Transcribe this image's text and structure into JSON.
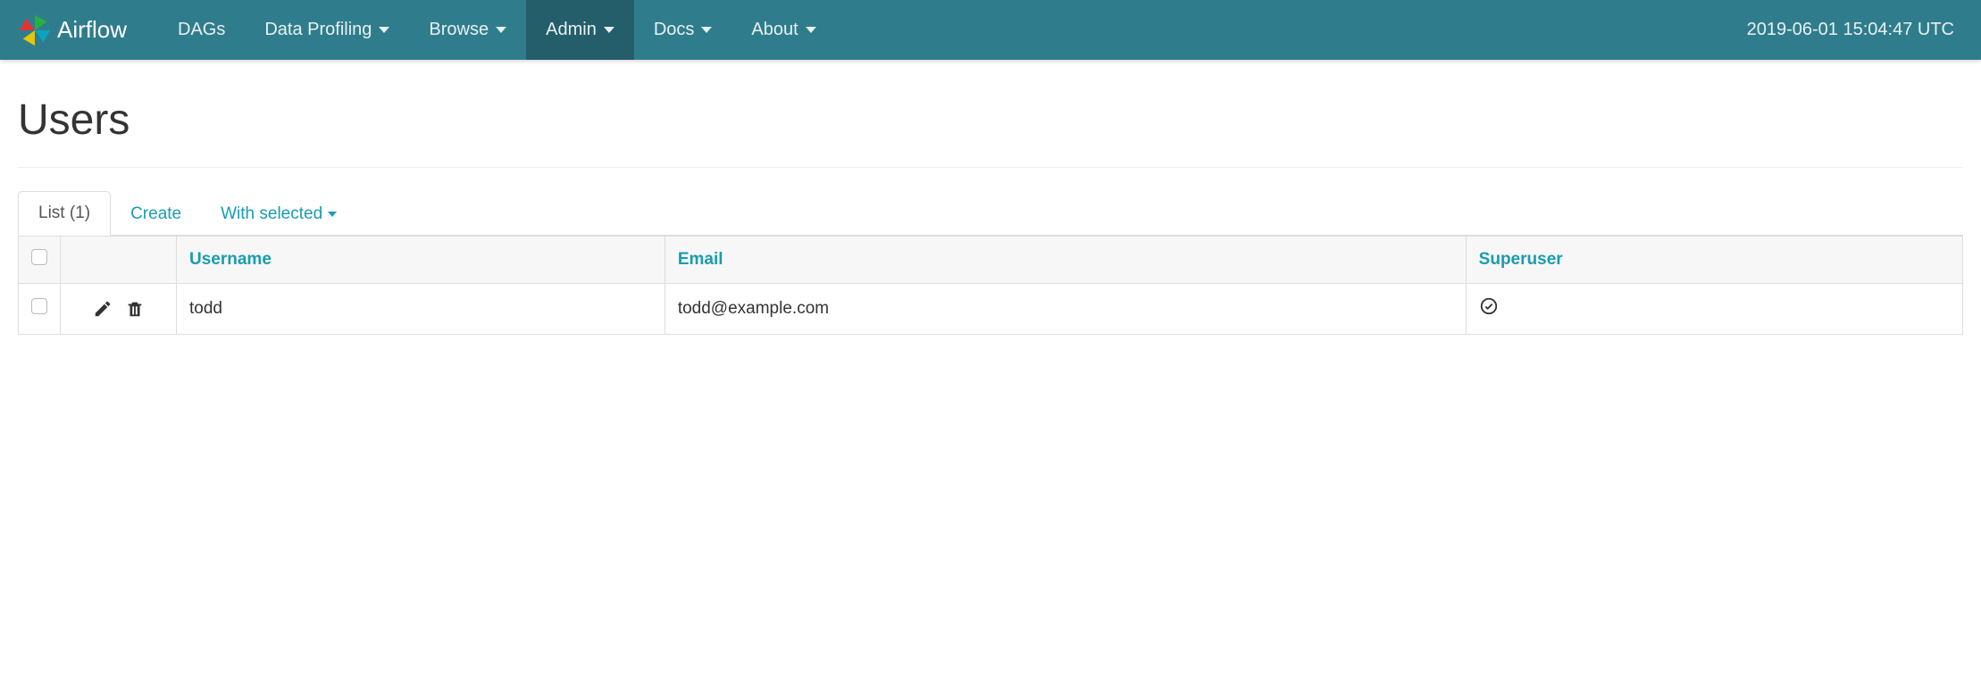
{
  "brand": {
    "name": "Airflow"
  },
  "nav": {
    "items": [
      {
        "label": "DAGs",
        "dropdown": false,
        "active": false
      },
      {
        "label": "Data Profiling",
        "dropdown": true,
        "active": false
      },
      {
        "label": "Browse",
        "dropdown": true,
        "active": false
      },
      {
        "label": "Admin",
        "dropdown": true,
        "active": true
      },
      {
        "label": "Docs",
        "dropdown": true,
        "active": false
      },
      {
        "label": "About",
        "dropdown": true,
        "active": false
      }
    ],
    "clock": "2019-06-01 15:04:47 UTC"
  },
  "page": {
    "title": "Users"
  },
  "tabs": [
    {
      "label": "List (1)",
      "active": true,
      "caret": false
    },
    {
      "label": "Create",
      "active": false,
      "caret": false
    },
    {
      "label": "With selected",
      "active": false,
      "caret": true
    }
  ],
  "table": {
    "columns": [
      "Username",
      "Email",
      "Superuser"
    ],
    "rows": [
      {
        "username": "todd",
        "email": "todd@example.com",
        "superuser": true
      }
    ]
  }
}
